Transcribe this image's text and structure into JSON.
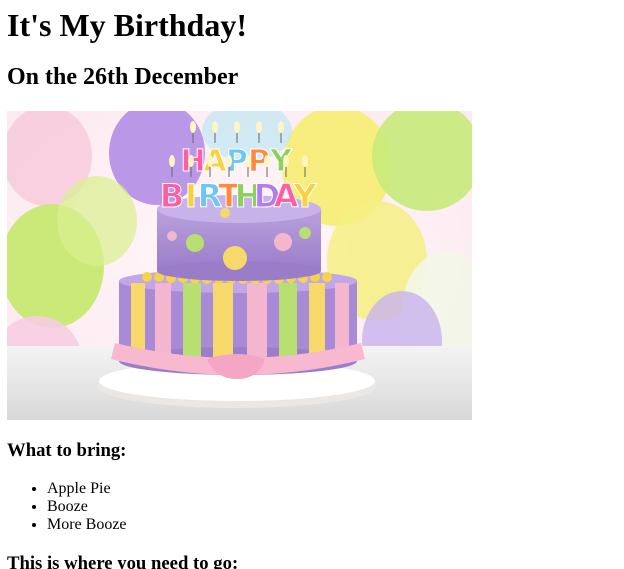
{
  "page": {
    "title": "It's My Birthday!",
    "subtitle": "On the 26th December"
  },
  "hero_image": {
    "alt": "Birthday cake with HAPPY BIRTHDAY candles",
    "letters_line1": [
      "H",
      "A",
      "P",
      "P",
      "Y"
    ],
    "letters_line2": [
      "B",
      "I",
      "R",
      "T",
      "H",
      "D",
      "A",
      "Y"
    ],
    "letter_colors": [
      "#ff5fa2",
      "#f7d23c",
      "#6ec6f5",
      "#ff8a3d",
      "#8bd15a",
      "#b07cf0"
    ]
  },
  "bring": {
    "heading": "What to bring:",
    "items": [
      "Apple Pie",
      "Booze",
      "More Booze"
    ]
  },
  "directions": {
    "heading": "This is where you need to go:"
  }
}
